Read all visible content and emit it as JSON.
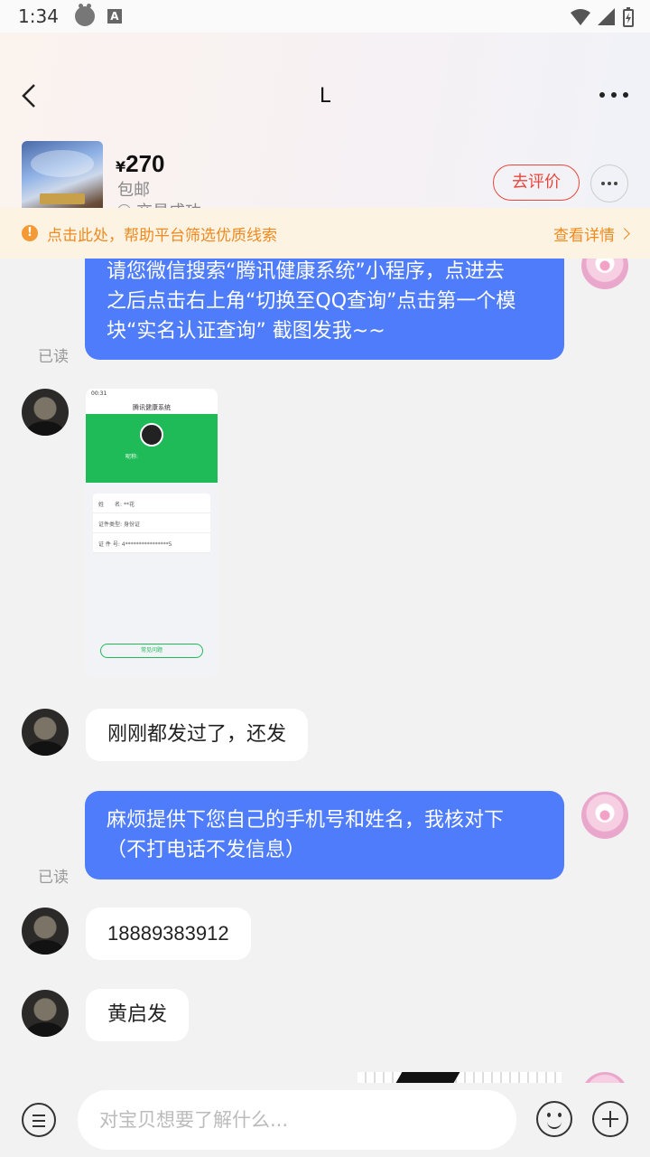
{
  "status_bar": {
    "time": "1:34"
  },
  "header": {
    "title": "L",
    "product": {
      "currency": "¥",
      "price": "270",
      "shipping": "包邮",
      "status": "交易成功"
    },
    "review_label": "去评价"
  },
  "notice": {
    "text": "点击此处，帮助平台筛选优质线索",
    "link": "查看详情"
  },
  "messages": [
    {
      "from": "seller",
      "lines": [
        "请您微信搜索“腾讯健康系统”小程序，点进去",
        "之后点击右上角“切换至QQ查询”点击第一个模",
        "块“实名认证查询” 截图发我~~"
      ],
      "read": "已读"
    },
    {
      "from": "user",
      "type": "image",
      "image": {
        "time": "00:31",
        "title": "腾讯健康系统",
        "nickname": "昵称:",
        "rows": [
          {
            "label": "姓　　名:",
            "value": "**花"
          },
          {
            "label": "证件类型:",
            "value": "身份证"
          },
          {
            "label": "证 件 号:",
            "value": "4****************5"
          }
        ],
        "button": "常见问题"
      }
    },
    {
      "from": "user",
      "text": "刚刚都发过了，还发"
    },
    {
      "from": "seller",
      "lines": [
        "麻烦提供下您自己的手机号和姓名，我核对下",
        "（不打电话不发信息）"
      ],
      "read": "已读"
    },
    {
      "from": "user",
      "text": "18889383912"
    },
    {
      "from": "user",
      "text": "黄启发"
    }
  ],
  "input": {
    "placeholder": "对宝贝想要了解什么..."
  },
  "colors": {
    "bubble_out": "#4e7cfb",
    "accent_red": "#e8473c",
    "notice": "#f08a1e"
  }
}
